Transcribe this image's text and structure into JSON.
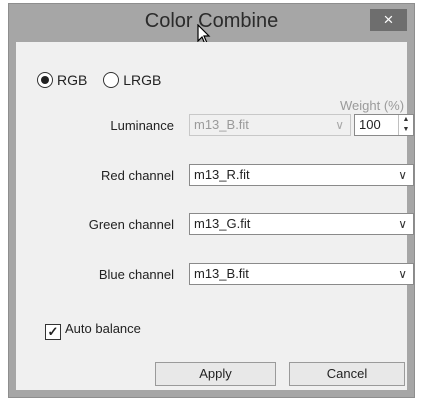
{
  "window": {
    "title": "Color Combine",
    "close_glyph": "×"
  },
  "mode": {
    "options": [
      "RGB",
      "LRGB"
    ],
    "selected": "RGB"
  },
  "weight_label": "Weight (%)",
  "luminance": {
    "label": "Luminance",
    "value": "m13_B.fit",
    "weight": "100",
    "enabled": false
  },
  "channels": [
    {
      "label": "Red channel",
      "value": "m13_R.fit"
    },
    {
      "label": "Green channel",
      "value": "m13_G.fit"
    },
    {
      "label": "Blue channel",
      "value": "m13_B.fit"
    }
  ],
  "auto_balance": {
    "label": "Auto balance",
    "checked": true
  },
  "buttons": {
    "apply": "Apply",
    "cancel": "Cancel"
  },
  "icons": {
    "close": "close-icon",
    "dropdown": "chevron-down-icon",
    "spin": "spinner-arrows-icon",
    "cursor": "mouse-pointer-icon"
  }
}
